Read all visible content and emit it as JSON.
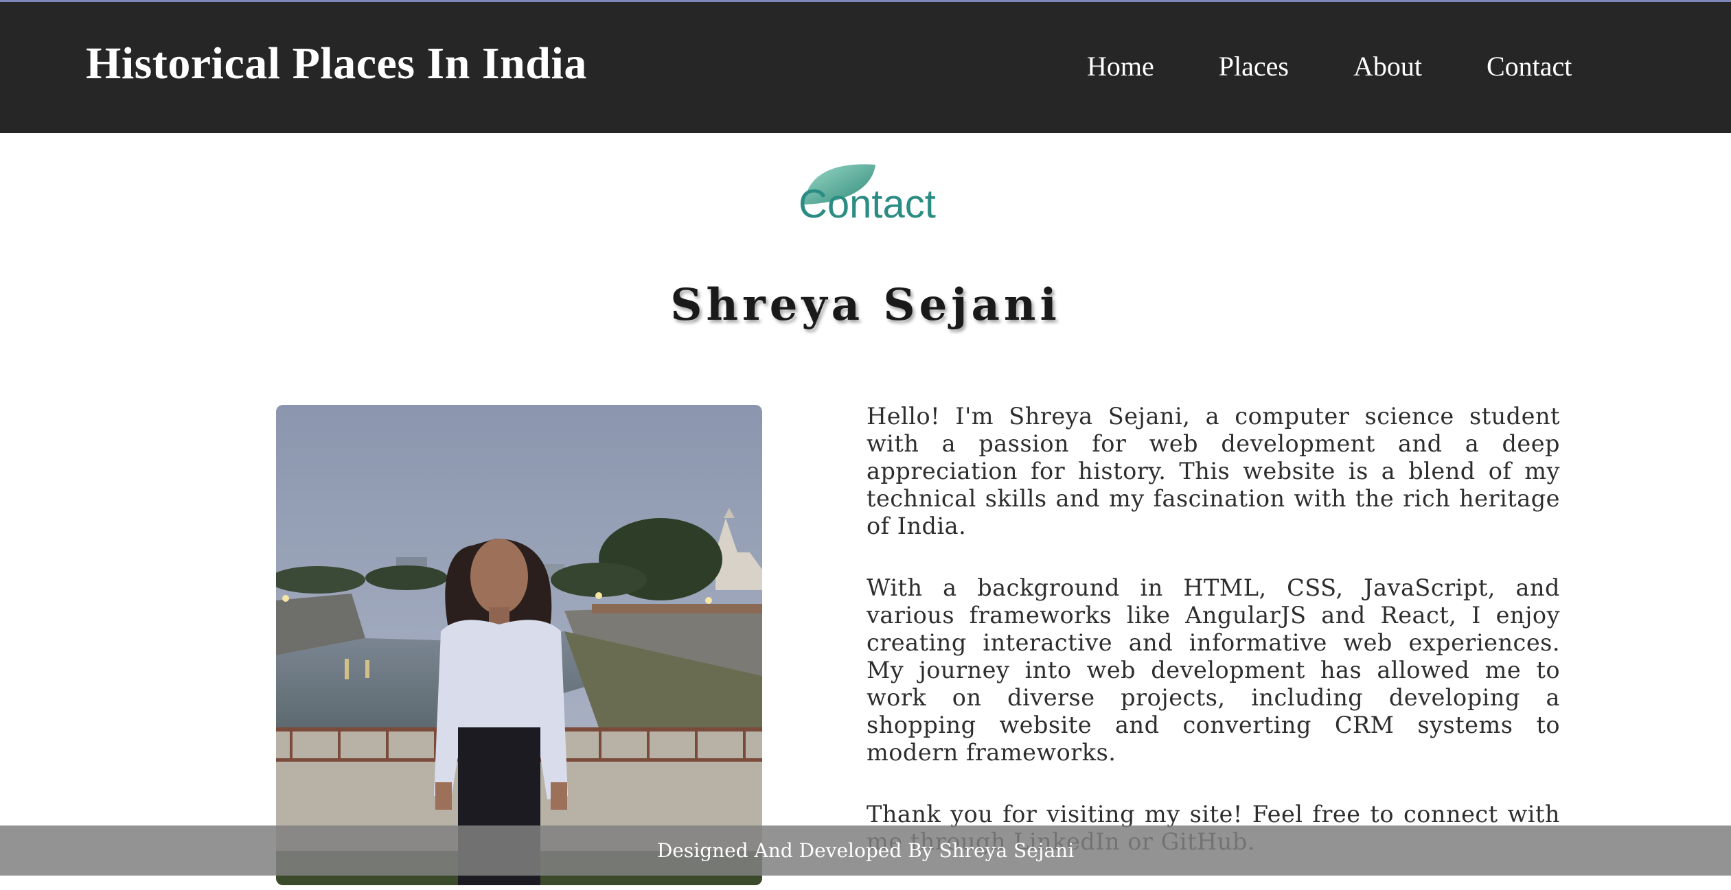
{
  "header": {
    "brand": "Historical Places In India",
    "nav": [
      {
        "label": "Home"
      },
      {
        "label": "Places"
      },
      {
        "label": "About"
      },
      {
        "label": "Contact"
      }
    ]
  },
  "contact": {
    "heading": "Contact",
    "name": "Shreya Sejani"
  },
  "bio": {
    "paragraphs": [
      "Hello! I'm Shreya Sejani, a computer science student with a passion for web development and a deep appreciation for history. This website is a blend of my technical skills and my fascination with the rich heritage of India.",
      "With a background in HTML, CSS, JavaScript, and various frameworks like AngularJS and React, I enjoy creating interactive and informative web experiences. My journey into web development has allowed me to work on diverse projects, including developing a shopping website and converting CRM systems to modern frameworks.",
      "Thank you for visiting my site! Feel free to connect with me through LinkedIn or GitHub."
    ]
  },
  "footer": {
    "text": "Designed And Developed By Shreya Sejani"
  },
  "colors": {
    "navbar": "#262626",
    "accent": "#2b8c83",
    "footer": "#808080"
  }
}
